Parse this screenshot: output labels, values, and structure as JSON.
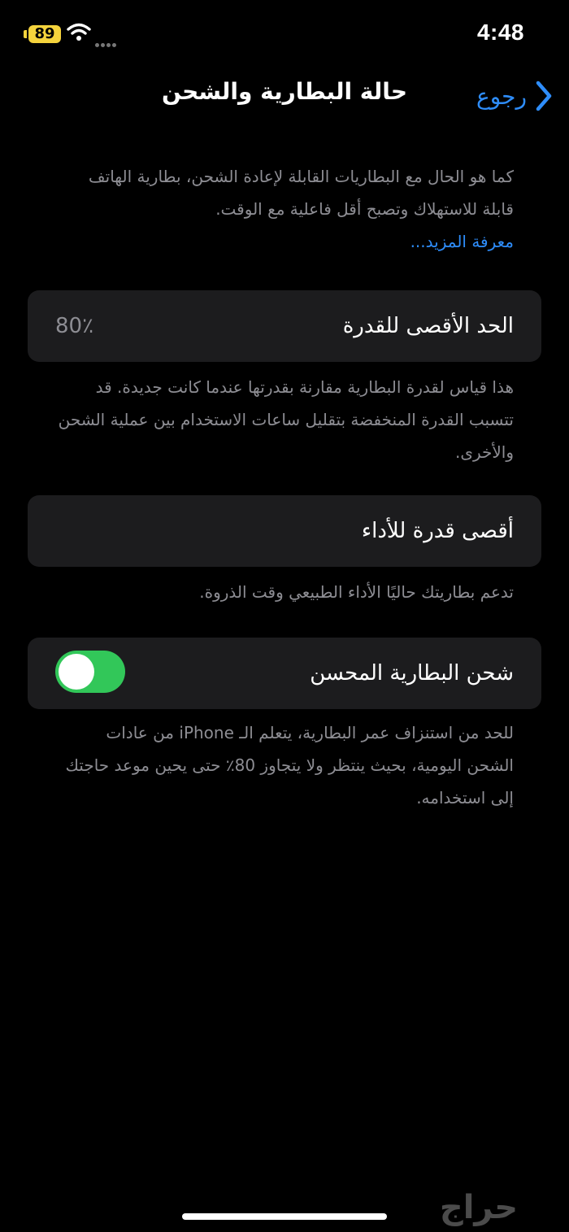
{
  "status_bar": {
    "battery_level": "89",
    "battery_color": "#f5d33c",
    "time": "4:48",
    "icons": [
      "battery-icon",
      "wifi-icon",
      "cellular-signal-icon"
    ]
  },
  "nav": {
    "title": "حالة البطارية والشحن",
    "back_label": "رجوع",
    "back_icon": "chevron-left-icon",
    "accent_color": "#2e8dfa"
  },
  "intro": {
    "text": "كما هو الحال مع البطاريات القابلة لإعادة الشحن، بطارية الهاتف قابلة للاستهلاك وتصبح أقل فاعلية مع الوقت.",
    "learn_more": "معرفة المزيد..."
  },
  "maximum_capacity": {
    "label": "الحد الأقصى للقدرة",
    "value": "80٪",
    "description": "هذا قياس لقدرة البطارية مقارنة بقدرتها عندما كانت جديدة. قد تتسبب القدرة المنخفضة بتقليل ساعات الاستخدام بين عملية الشحن والأخرى."
  },
  "peak_performance": {
    "label": "أقصى قدرة للأداء",
    "description": "تدعم بطاريتك حاليًا الأداء الطبيعي وقت الذروة."
  },
  "optimized_charging": {
    "label": "شحن البطارية المحسن",
    "enabled": true,
    "toggle_color": "#32c759",
    "description": "للحد من استنزاف عمر البطارية، يتعلم الـ iPhone من عادات الشحن اليومية، بحيث ينتظر ولا يتجاوز 80٪ حتى يحين موعد حاجتك إلى استخدامه."
  },
  "watermark": {
    "text": "حراج"
  }
}
